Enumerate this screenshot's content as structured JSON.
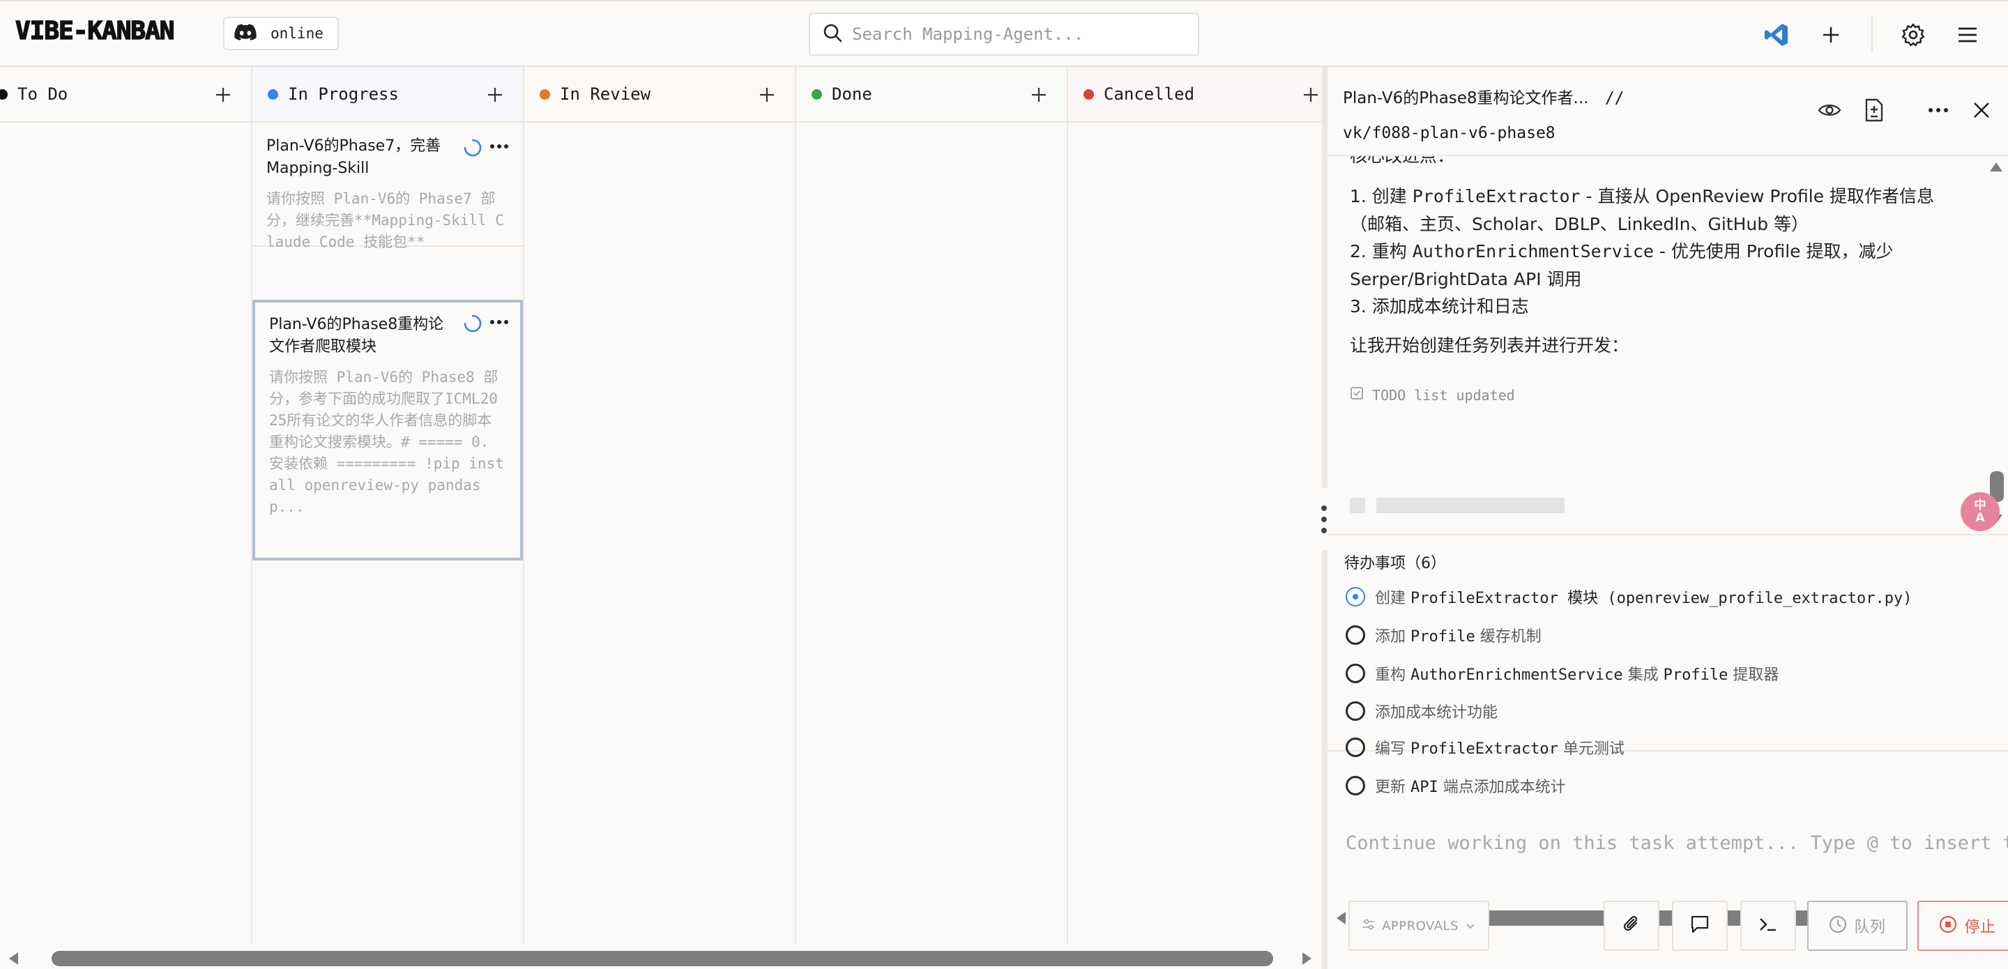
{
  "app": {
    "logo": "VIBE-KANBAN",
    "discord_status": "online"
  },
  "search": {
    "placeholder": "Search Mapping-Agent..."
  },
  "columns": [
    {
      "title": "To Do",
      "color": "#111111"
    },
    {
      "title": "In Progress",
      "color": "#3b82f6"
    },
    {
      "title": "In Review",
      "color": "#e07a2a"
    },
    {
      "title": "Done",
      "color": "#3fa34d"
    },
    {
      "title": "Cancelled",
      "color": "#e03e3e"
    }
  ],
  "cards": [
    {
      "title": "Plan-V6的Phase7，完善Mapping-Skill",
      "description": "请你按照 Plan-V6的 Phase7 部分，继续完善**Mapping-Skill Claude Code 技能包**"
    },
    {
      "title": "Plan-V6的Phase8重构论文作者爬取模块",
      "description": "请你按照 Plan-V6的 Phase8 部分，参考下面的成功爬取了ICML2025所有论文的华人作者信息的脚本重构论文搜索模块。# ===== 0. 安装依赖 ========= !pip install openreview-py pandas p..."
    }
  ],
  "panel": {
    "title": "Plan-V6的Phase8重构论文作者...",
    "separator": "//",
    "branch": "vk/f088-plan-v6-phase8",
    "log": {
      "cut_line": "核心改进点：",
      "item1_prefix": "1. 创建 ",
      "item1_code": "ProfileExtractor",
      "item1_rest": " - 直接从 OpenReview Profile 提取作者信息（邮箱、主页、Scholar、DBLP、LinkedIn、GitHub 等）",
      "item2_prefix": "2. 重构 ",
      "item2_code": "AuthorEnrichmentService",
      "item2_rest": " - 优先使用 Profile 提取，减少 Serper/BrightData API 调用",
      "item3": "3. 添加成本统计和日志",
      "start_line": "让我开始创建任务列表并进行开发：",
      "todo_updated": "TODO list updated"
    },
    "todos": {
      "header": "待办事项（6）",
      "items": [
        {
          "pre": "创建 ",
          "code": "ProfileExtractor",
          "post": " 模块 (openreview_profile_extractor.py)",
          "state": "in-progress"
        },
        {
          "pre": "添加 ",
          "code": "Profile",
          "post": " 缓存机制",
          "state": "pending"
        },
        {
          "pre": "重构 ",
          "code": "AuthorEnrichmentService",
          "post": " 集成 ",
          "code2": "Profile",
          "post2": " 提取器",
          "state": "pending"
        },
        {
          "pre": "添加成本统计功能",
          "code": "",
          "post": "",
          "state": "pending"
        },
        {
          "pre": "编写 ",
          "code": "ProfileExtractor",
          "post": " 单元测试",
          "state": "pending"
        },
        {
          "pre": "更新 ",
          "code": "API",
          "post": " 端点添加成本统计",
          "state": "pending"
        }
      ]
    },
    "input": {
      "placeholder": "Continue working on this task attempt... Type @ to insert tags or search files."
    },
    "toolbar": {
      "approvals": "APPROVALS",
      "queue": "队列",
      "stop": "停止"
    },
    "translate_badge": "中\nA"
  }
}
